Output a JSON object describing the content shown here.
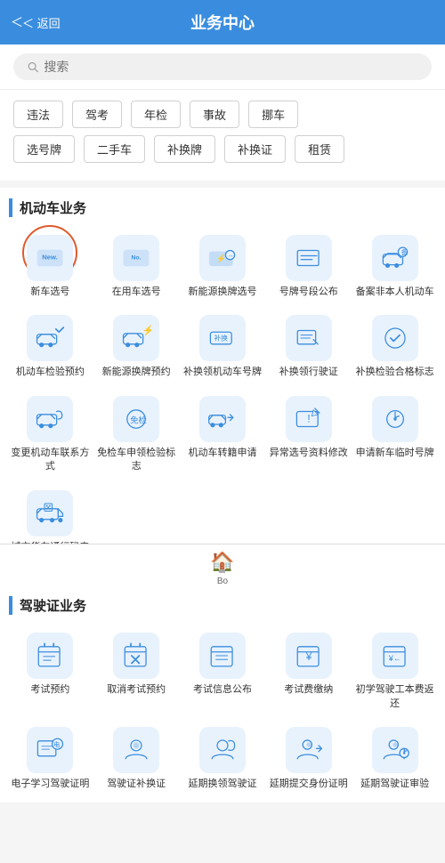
{
  "header": {
    "back_label": "＜ 返回",
    "title": "业务中心"
  },
  "search": {
    "placeholder": "搜索"
  },
  "quick_tags": {
    "row1": [
      "违法",
      "驾考",
      "年检",
      "事故",
      "挪车"
    ],
    "row2": [
      "选号牌",
      "二手车",
      "补换牌",
      "补换证",
      "租赁"
    ]
  },
  "sections": [
    {
      "id": "motor",
      "title": "机动车业务",
      "items": [
        {
          "label": "新车选号",
          "icon": "new-plate",
          "circled": true
        },
        {
          "label": "在用车选号",
          "icon": "used-plate",
          "circled": false
        },
        {
          "label": "新能源换牌选号",
          "icon": "ev-plate",
          "circled": false
        },
        {
          "label": "号牌号段公布",
          "icon": "plate-publish",
          "circled": false
        },
        {
          "label": "备案非本人机动车",
          "icon": "backup-car",
          "circled": false
        },
        {
          "label": "机动车检验预约",
          "icon": "car-check",
          "circled": false
        },
        {
          "label": "新能源换牌预约",
          "icon": "ev-appt",
          "circled": false
        },
        {
          "label": "补换领机动车号牌",
          "icon": "replace-plate",
          "circled": false
        },
        {
          "label": "补换领行驶证",
          "icon": "replace-license",
          "circled": false
        },
        {
          "label": "补换检验合格标志",
          "icon": "replace-sticker",
          "circled": false
        },
        {
          "label": "变更机动车联系方式",
          "icon": "change-contact",
          "circled": false
        },
        {
          "label": "免检车申领检验标志",
          "icon": "exempt-sticker",
          "circled": false
        },
        {
          "label": "机动车转籍申请",
          "icon": "transfer-car",
          "circled": false
        },
        {
          "label": "异常选号资料修改",
          "icon": "abnormal-modify",
          "circled": false
        },
        {
          "label": "申请新车临时号牌",
          "icon": "temp-plate",
          "circled": false
        },
        {
          "label": "城市货车通行码申领",
          "icon": "truck-code",
          "circled": false
        }
      ]
    },
    {
      "id": "driver",
      "title": "驾驶证业务",
      "items": [
        {
          "label": "考试预约",
          "icon": "exam-appt",
          "circled": false
        },
        {
          "label": "取消考试预约",
          "icon": "cancel-exam",
          "circled": false
        },
        {
          "label": "考试信息公布",
          "icon": "exam-info",
          "circled": false
        },
        {
          "label": "考试费缴纳",
          "icon": "exam-fee",
          "circled": false
        },
        {
          "label": "初学驾驶工本费返还",
          "icon": "refund-fee",
          "circled": false
        },
        {
          "label": "电子学习驾驶证明",
          "icon": "e-study",
          "circled": false
        },
        {
          "label": "驾驶证补换证",
          "icon": "replace-dl",
          "circled": false
        },
        {
          "label": "延期换领驾驶证",
          "icon": "renew-dl",
          "circled": false
        },
        {
          "label": "延期提交身份证明",
          "icon": "extend-id",
          "circled": false
        },
        {
          "label": "延期驾驶证审验",
          "icon": "extend-audit",
          "circled": false
        }
      ]
    }
  ],
  "bottom_tabs": [
    {
      "label": "Bo",
      "icon": "home-icon"
    }
  ]
}
